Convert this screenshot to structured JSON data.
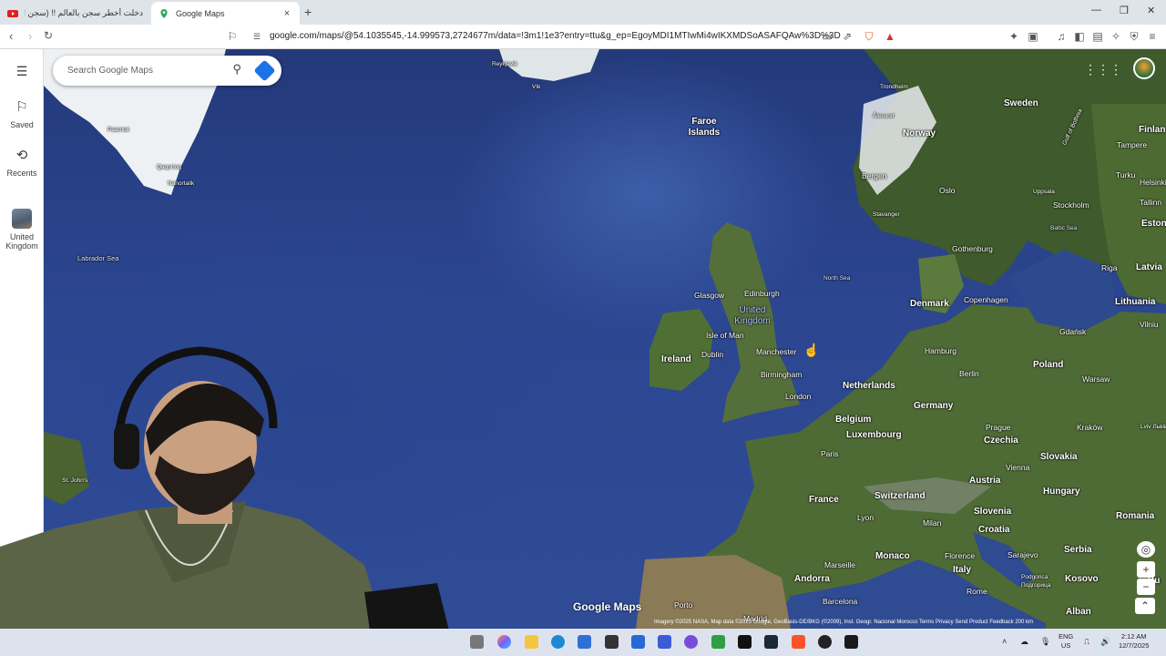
{
  "browser": {
    "tabs": [
      {
        "title": "دخلت أخطر سجن بالعالم !! (سجن العد...",
        "close": "×"
      },
      {
        "title": "Google Maps",
        "close": "×"
      }
    ],
    "new_tab": "+",
    "url": "google.com/maps/@54.1035545,-14.999573,2724677m/data=!3m1!1e3?entry=ttu&g_ep=EgoyMDI1MTIwMi4wIKXMDSoASAFQAw%3D%3D"
  },
  "sidebar": {
    "items": [
      {
        "label": "Saved"
      },
      {
        "label": "Recents"
      },
      {
        "label": "United Kingdom"
      }
    ]
  },
  "search": {
    "placeholder": "Search Google Maps"
  },
  "map": {
    "labels": {
      "reykjavik": "Reykjavik",
      "vik": "Vík",
      "paamiut": "Paamiut",
      "qaqortoq": "Qaqortoq",
      "nanortalik": "Nanortalik",
      "labrador_sea": "Labrador Sea",
      "st_johns": "St. John's",
      "faroe": "Faroe Islands",
      "trondheim": "Trondheim",
      "alesund": "Ålesund",
      "norway": "Norway",
      "bergen": "Bergen",
      "oslo": "Oslo",
      "stavanger": "Stavanger",
      "sweden": "Sweden",
      "gulf_bothnia": "Gulf of Bothnia",
      "finland": "Finlan",
      "tampere": "Tampere",
      "turku": "Turku",
      "helsinki": "Helsinki",
      "uppsala": "Uppsala",
      "stockholm": "Stockholm",
      "tallinn": "Tallinn",
      "estonia": "Estonia",
      "baltic_sea": "Baltic Sea",
      "riga": "Riga",
      "latvia": "Latvia",
      "north_sea": "North Sea",
      "gothenburg": "Gothenburg",
      "glasgow": "Glasgow",
      "edinburgh": "Edinburgh",
      "uk": "United Kingdom",
      "denmark": "Denmark",
      "copenhagen": "Copenhagen",
      "lithuania": "Lithuania",
      "vilnius": "Vilniu",
      "isle_of_man": "Isle of Man",
      "dublin": "Dublin",
      "ireland": "Ireland",
      "manchester": "Manchester",
      "birmingham": "Birmingham",
      "london": "London",
      "hamburg": "Hamburg",
      "gdansk": "Gdańsk",
      "berlin": "Berlin",
      "poland": "Poland",
      "warsaw": "Warsaw",
      "netherlands": "Netherlands",
      "germany": "Germany",
      "belgium": "Belgium",
      "luxembourg": "Luxembourg",
      "prague": "Prague",
      "czechia": "Czechia",
      "krakow": "Kraków",
      "lviv": "Lviv Львів",
      "paris": "Paris",
      "vienna": "Vienna",
      "slovakia": "Slovakia",
      "austria": "Austria",
      "france": "France",
      "switzerland": "Switzerland",
      "hungary": "Hungary",
      "lyon": "Lyon",
      "milan": "Milan",
      "slovenia": "Slovenia",
      "croatia": "Croatia",
      "romania": "Romania",
      "monaco": "Monaco",
      "marseille": "Marseille",
      "florence": "Florence",
      "sarajevo": "Sarajevo",
      "serbia": "Serbia",
      "andorra": "Andorra",
      "italy": "Italy",
      "podgorica": "Podgorica Подгорица",
      "kosovo": "Kosovo",
      "rome": "Rome",
      "barcelona": "Barcelona",
      "porto": "Porto",
      "madrid": "Madrid",
      "albania": "Alban",
      "bulgaria": "Bu"
    },
    "logo": "Google Maps",
    "attribution": "Imagery ©2025 NASA, Map data ©2025 Google, GeoBasis-DE/BKG (©2009), Inst. Geogr. Nacional    Morocco    Terms    Privacy    Send Product Feedback    200 km"
  },
  "taskbar": {
    "lang": "ENG\nUS",
    "time": "2:12 AM",
    "date": "12/7/2025"
  },
  "colors": {
    "sea": "#2c4690",
    "land": "#4e6b35",
    "snow": "#eef1f3",
    "accent": "#1a73e8"
  }
}
